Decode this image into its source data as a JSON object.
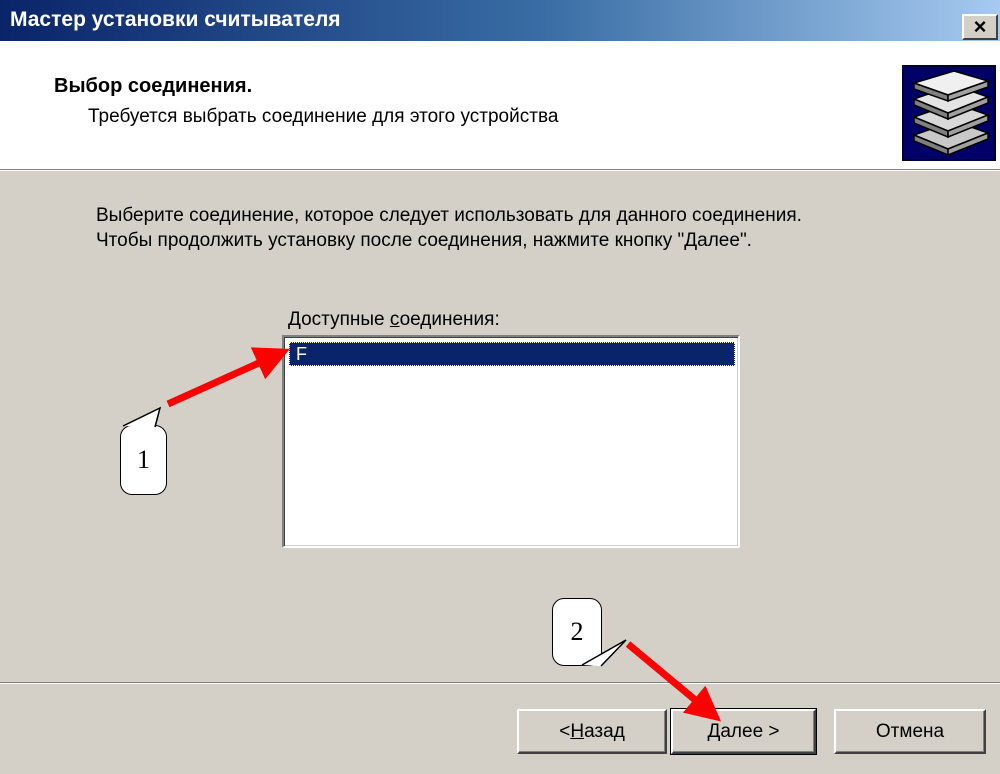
{
  "window": {
    "title": "Мастер установки считывателя",
    "close_label": "×"
  },
  "header": {
    "title": "Выбор соединения.",
    "subtitle": "Требуется выбрать соединение для этого устройства",
    "icon": "stacked-disks-icon"
  },
  "body": {
    "line1": "Выберите соединение, которое следует использовать для данного соединения.",
    "line2": "Чтобы продолжить установку после соединения, нажмите кнопку \"Далее\"."
  },
  "connections": {
    "label_before": "Доступные ",
    "label_underlined": "с",
    "label_after": "оединения:",
    "items": [
      "F"
    ],
    "selected_index": 0
  },
  "buttons": {
    "back_prefix": "< ",
    "back_underlined": "Н",
    "back_rest": "азад",
    "next_underlined": "Д",
    "next_rest": "алее >",
    "cancel": "Отмена"
  },
  "annotations": {
    "callout_1": "1",
    "callout_2": "2",
    "arrow_color": "#ff0000"
  },
  "colors": {
    "title_bar_start": "#0a246a",
    "title_bar_end": "#a6caf0",
    "dialog_bg": "#d4d0c8",
    "selection": "#0a246a"
  }
}
